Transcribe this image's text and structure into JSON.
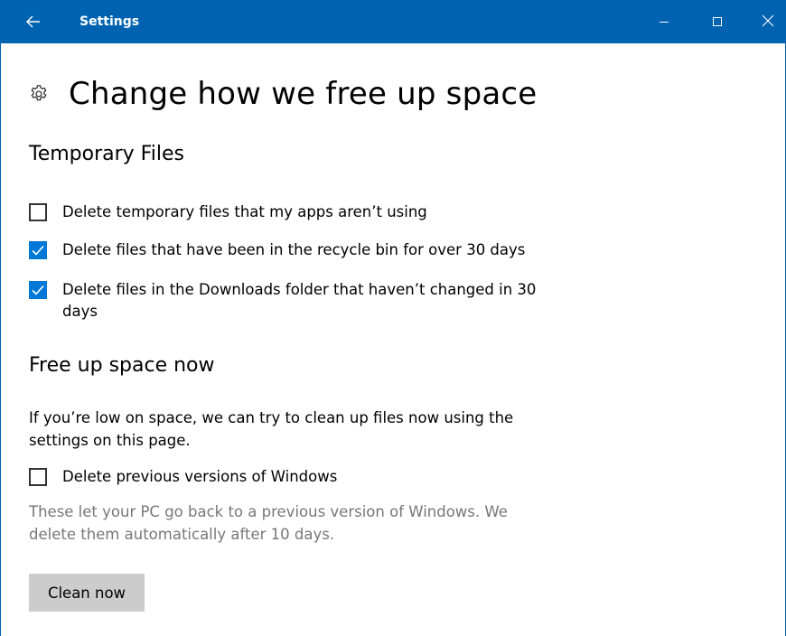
{
  "window": {
    "title": "Settings",
    "accent_color": "#0063b1",
    "controls": {
      "back_icon": "back-arrow-icon",
      "minimize_icon": "minimize-icon",
      "maximize_icon": "maximize-icon",
      "close_icon": "close-icon"
    }
  },
  "page": {
    "icon": "gear-icon",
    "title": "Change how we free up space"
  },
  "temporary_files": {
    "heading": "Temporary Files",
    "options": [
      {
        "label": "Delete temporary files that my apps aren’t using",
        "checked": false
      },
      {
        "label": "Delete files that have been in the recycle bin for over 30 days",
        "checked": true
      },
      {
        "label": "Delete files in the Downloads folder that haven’t changed in 30 days",
        "checked": true
      }
    ]
  },
  "free_up_now": {
    "heading": "Free up space now",
    "description": "If you’re low on space, we can try to clean up files now using the settings on this page.",
    "previous_windows": {
      "label": "Delete previous versions of Windows",
      "checked": false
    },
    "note": "These let your PC go back to a previous version of Windows. We delete them automatically after 10 days.",
    "clean_button": "Clean now"
  },
  "colors": {
    "checkbox_checked": "#0078d7",
    "note_text": "#777777",
    "button_bg": "#cccccc"
  }
}
